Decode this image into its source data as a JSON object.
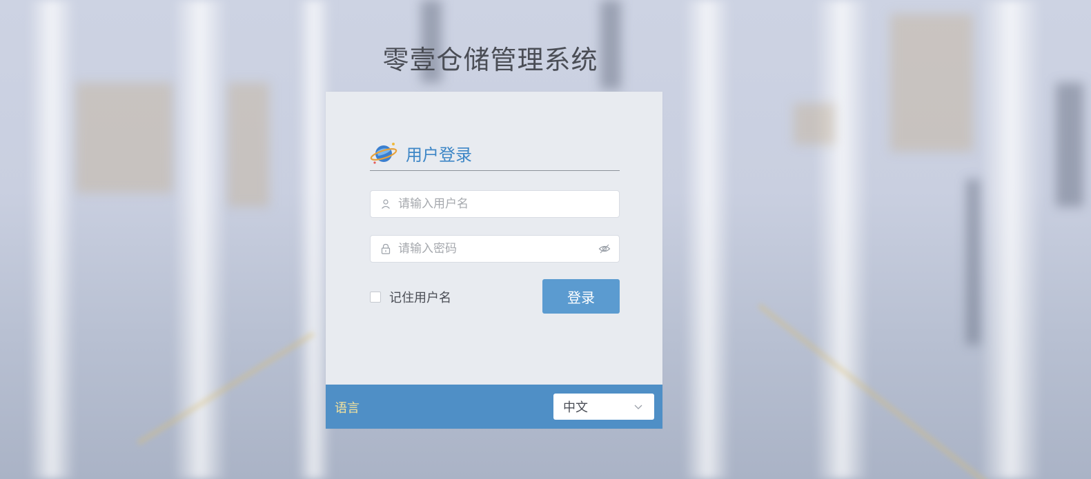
{
  "app": {
    "title": "零壹仓储管理系统"
  },
  "login": {
    "heading": "用户登录",
    "username_placeholder": "请输入用户名",
    "password_placeholder": "请输入密码",
    "remember_label": "记住用户名",
    "submit_label": "登录"
  },
  "footer": {
    "language_label": "语言",
    "language_value": "中文"
  },
  "colors": {
    "accent": "#5b9bd0",
    "footer_bg": "#4f8fc6",
    "heading": "#3d86c6",
    "language_label": "#f4e39c"
  },
  "icons": {
    "logo": "planet-icon",
    "username": "user-icon",
    "password": "lock-icon",
    "toggle_visibility": "eye-off-icon",
    "dropdown": "chevron-down-icon"
  }
}
